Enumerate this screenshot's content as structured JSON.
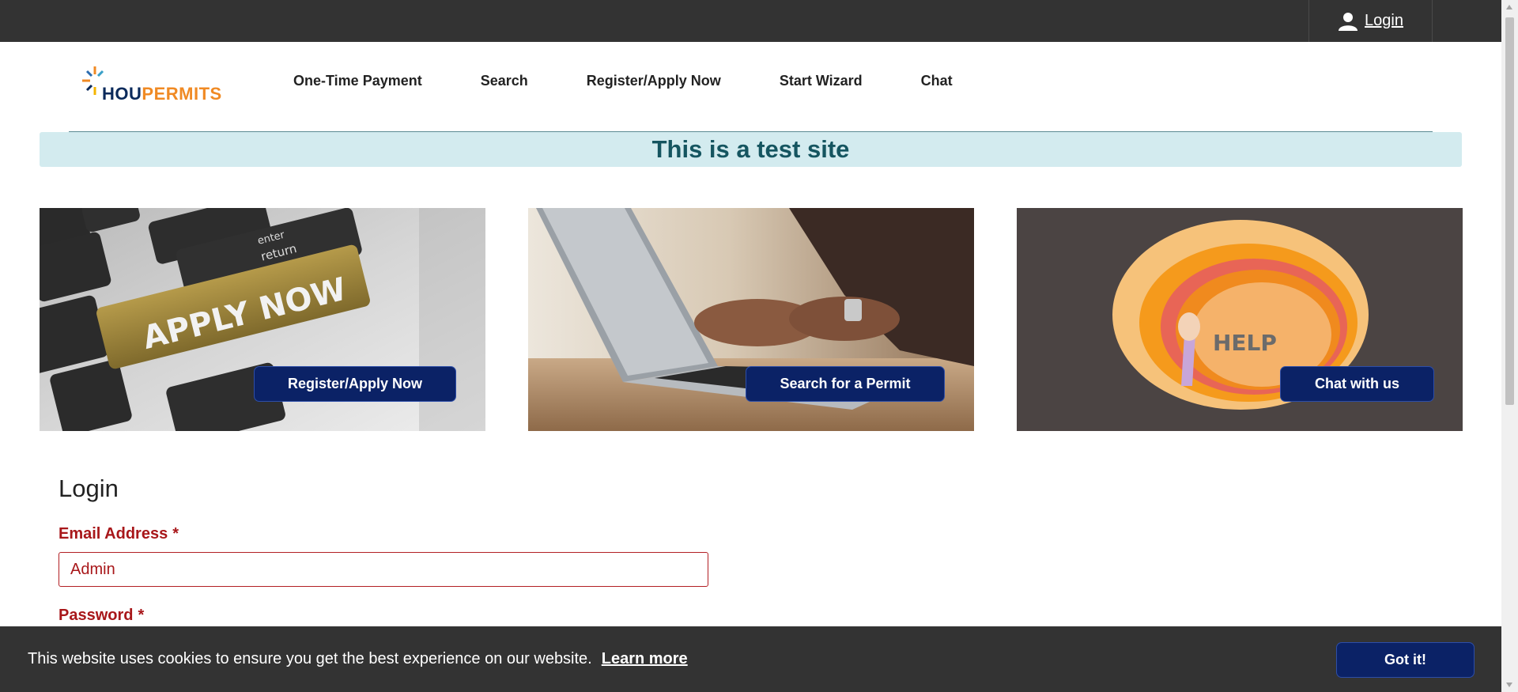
{
  "header": {
    "login_label": "Login"
  },
  "logo": {
    "part1": "HOU",
    "part2": "PERMITS"
  },
  "nav": {
    "items": [
      {
        "label": "One-Time Payment"
      },
      {
        "label": "Search"
      },
      {
        "label": "Register/Apply Now"
      },
      {
        "label": "Start Wizard"
      },
      {
        "label": "Chat"
      }
    ]
  },
  "banner": {
    "text": "This is a test site"
  },
  "cards": [
    {
      "button": "Register/Apply Now",
      "image_text": "APPLY NOW",
      "key_enter": "enter",
      "key_return": "return"
    },
    {
      "button": "Search for a Permit"
    },
    {
      "button": "Chat with us",
      "image_text": "HELP"
    }
  ],
  "login_form": {
    "title": "Login",
    "email_label": "Email Address",
    "email_value": "Admin",
    "password_label": "Password",
    "required_mark": "*"
  },
  "cookie": {
    "message": "This website uses cookies to ensure you get the best experience on our website.",
    "learn_more": "Learn more",
    "accept": "Got it!"
  },
  "colors": {
    "topbar": "#333333",
    "button_navy": "#0b2266",
    "banner_bg": "#d3ebef",
    "banner_text": "#155560",
    "error_red": "#a8171a",
    "logo_navy": "#0b2a5b",
    "logo_orange": "#f08a24"
  }
}
